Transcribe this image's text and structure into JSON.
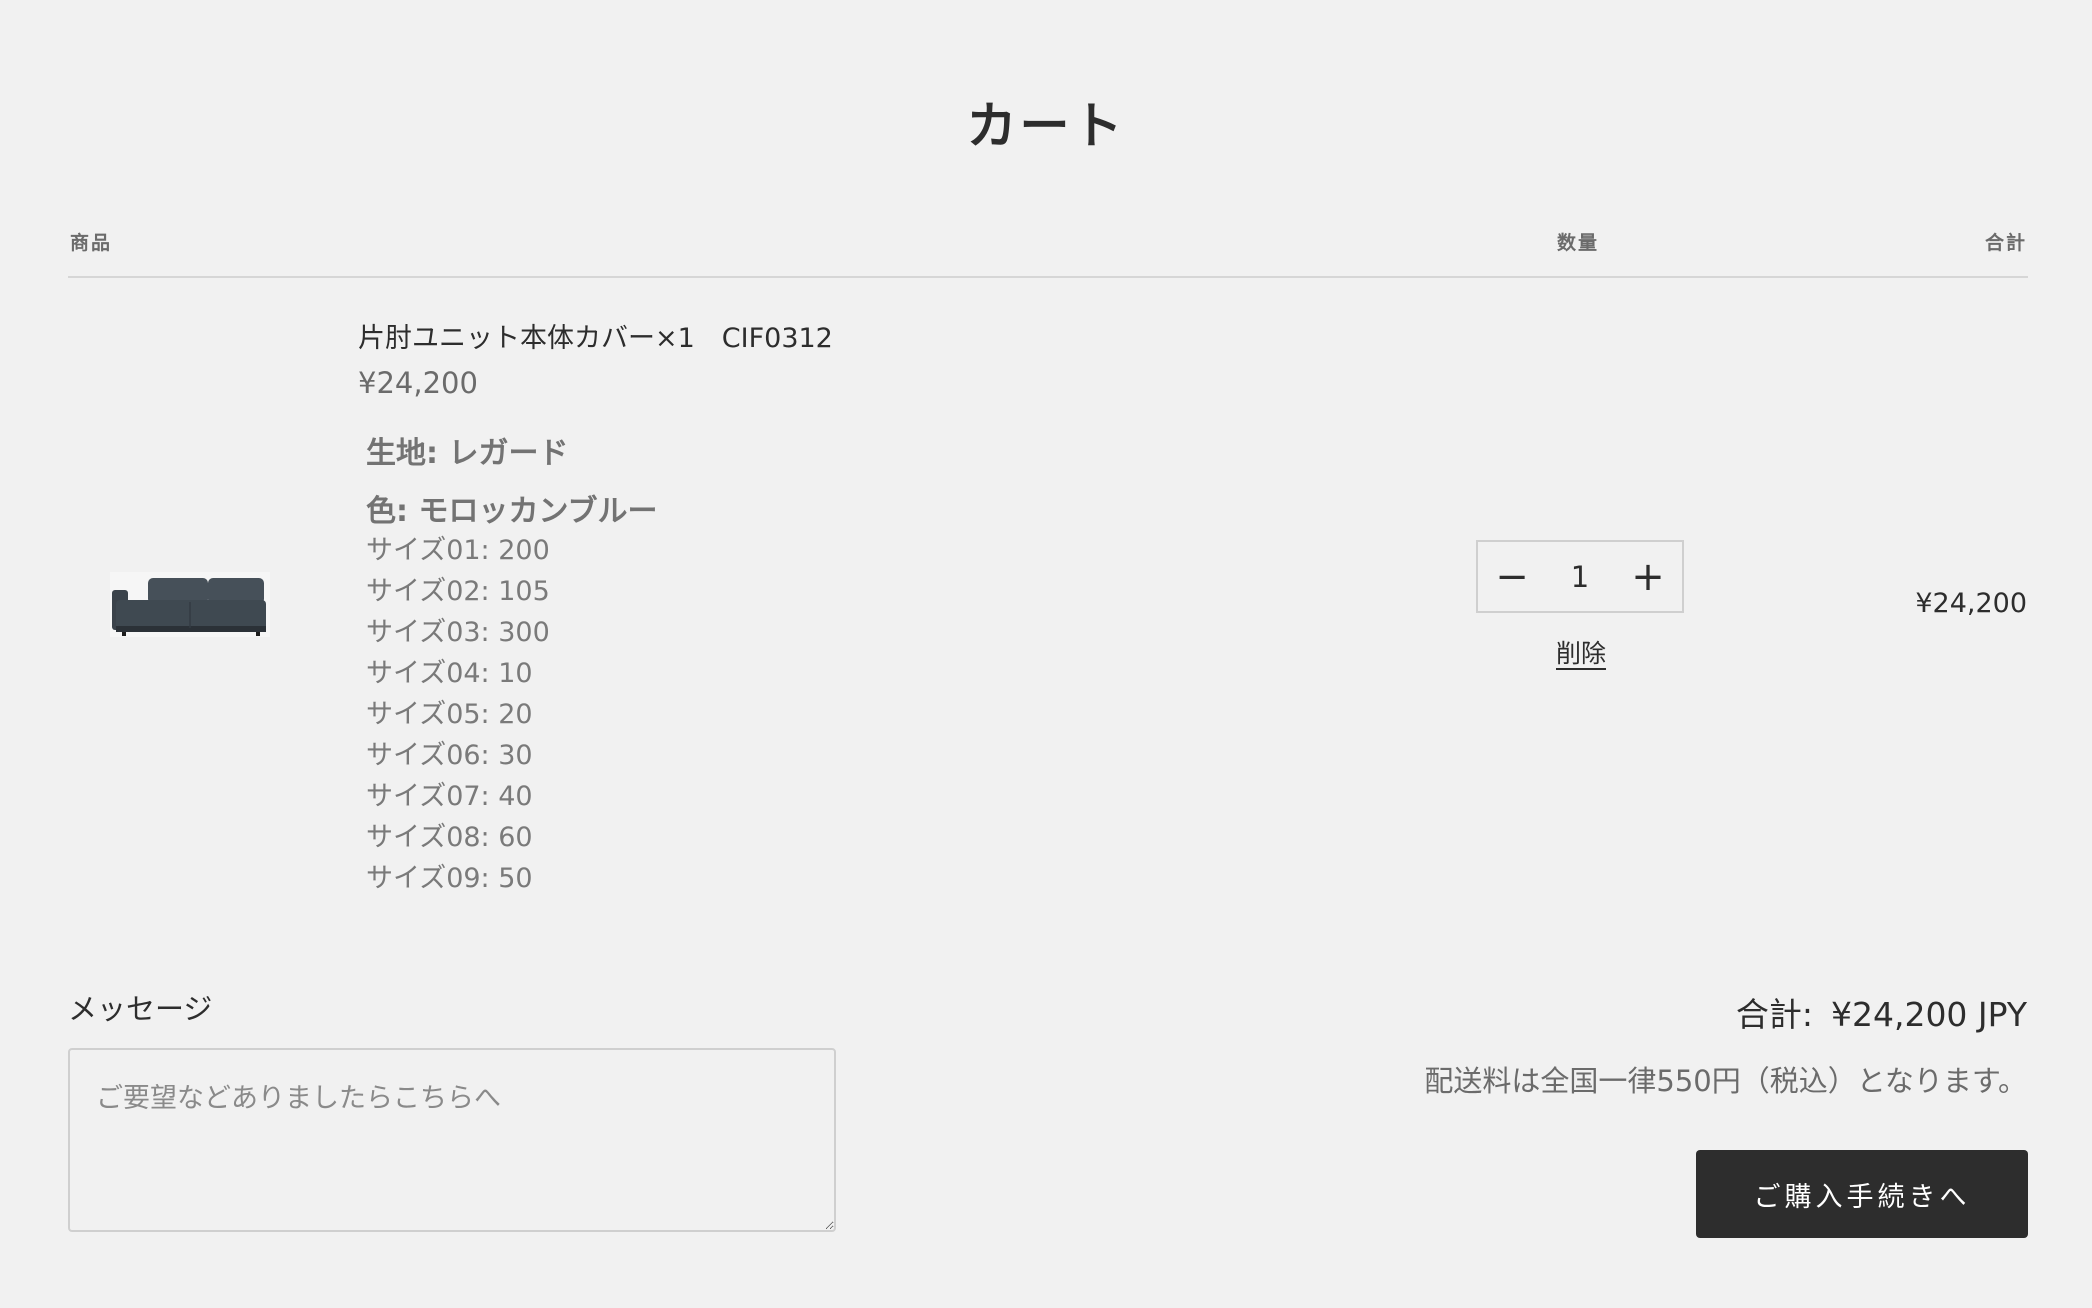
{
  "page": {
    "title": "カート"
  },
  "table_headers": {
    "product": "商品",
    "quantity": "数量",
    "total": "合計"
  },
  "item": {
    "name": "片肘ユニット本体カバー×1　CIF0312",
    "price": "¥24,200",
    "fabric": "生地: レガード",
    "color": "色: モロッカンブルー",
    "sizes": [
      "サイズ01: 200",
      "サイズ02: 105",
      "サイズ03: 300",
      "サイズ04: 10",
      "サイズ05: 20",
      "サイズ06: 30",
      "サイズ07: 40",
      "サイズ08: 60",
      "サイズ09: 50"
    ],
    "quantity": "1",
    "remove_label": "削除",
    "line_total": "¥24,200",
    "decrement_symbol": "−",
    "increment_symbol": "+"
  },
  "message": {
    "label": "メッセージ",
    "placeholder": "ご要望などありましたらこちらへ",
    "value": ""
  },
  "summary": {
    "subtotal_label": "合計:",
    "subtotal_value": "¥24,200 JPY",
    "shipping_note": "配送料は全国一律550円（税込）となります。",
    "checkout_label": "ご購入手続きへ"
  }
}
